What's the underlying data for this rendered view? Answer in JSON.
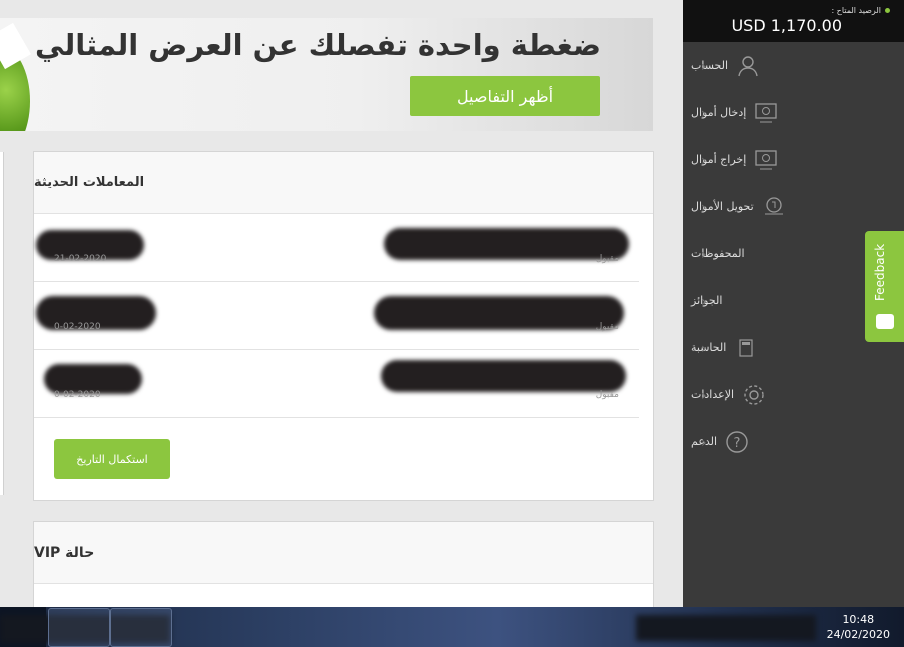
{
  "banner": {
    "title": "ضغطة واحدة تفصلك عن العرض المثالي",
    "button_label": "أظهر التفاصيل"
  },
  "transactions": {
    "title": "المعاملات الحديثة",
    "rows": [
      {
        "status": "مقبول",
        "date": "21-02-2020"
      },
      {
        "status": "مقبول",
        "date": "0-02-2020"
      },
      {
        "status": "مقبول",
        "date": "0-02-2020"
      }
    ],
    "history_button": "استكمال التاريخ"
  },
  "vip": {
    "title": "حالة VIP"
  },
  "sidebar": {
    "balance_label": "الرصيد المتاح :",
    "balance_value": "USD 1,170.00",
    "items": [
      {
        "label": "الحساب",
        "icon": "user-icon"
      },
      {
        "label": "إدخال أموال",
        "icon": "deposit-icon"
      },
      {
        "label": "إخراج أموال",
        "icon": "withdraw-icon"
      },
      {
        "label": "تحويل الأموال",
        "icon": "transfer-icon"
      },
      {
        "label": "المحفوظات",
        "icon": "history-icon"
      },
      {
        "label": "الجوائز",
        "icon": "trophy-icon"
      },
      {
        "label": "الحاسبة",
        "icon": "calculator-icon"
      },
      {
        "label": "الإعدادات",
        "icon": "gear-icon"
      },
      {
        "label": "الدعم",
        "icon": "help-icon"
      }
    ]
  },
  "feedback": {
    "label": "Feedback"
  },
  "taskbar": {
    "time": "10:48",
    "date": "24/02/2020"
  },
  "colors": {
    "accent": "#8cc63f",
    "sidebar": "#3a3a3a",
    "balance_bg": "#111111"
  }
}
